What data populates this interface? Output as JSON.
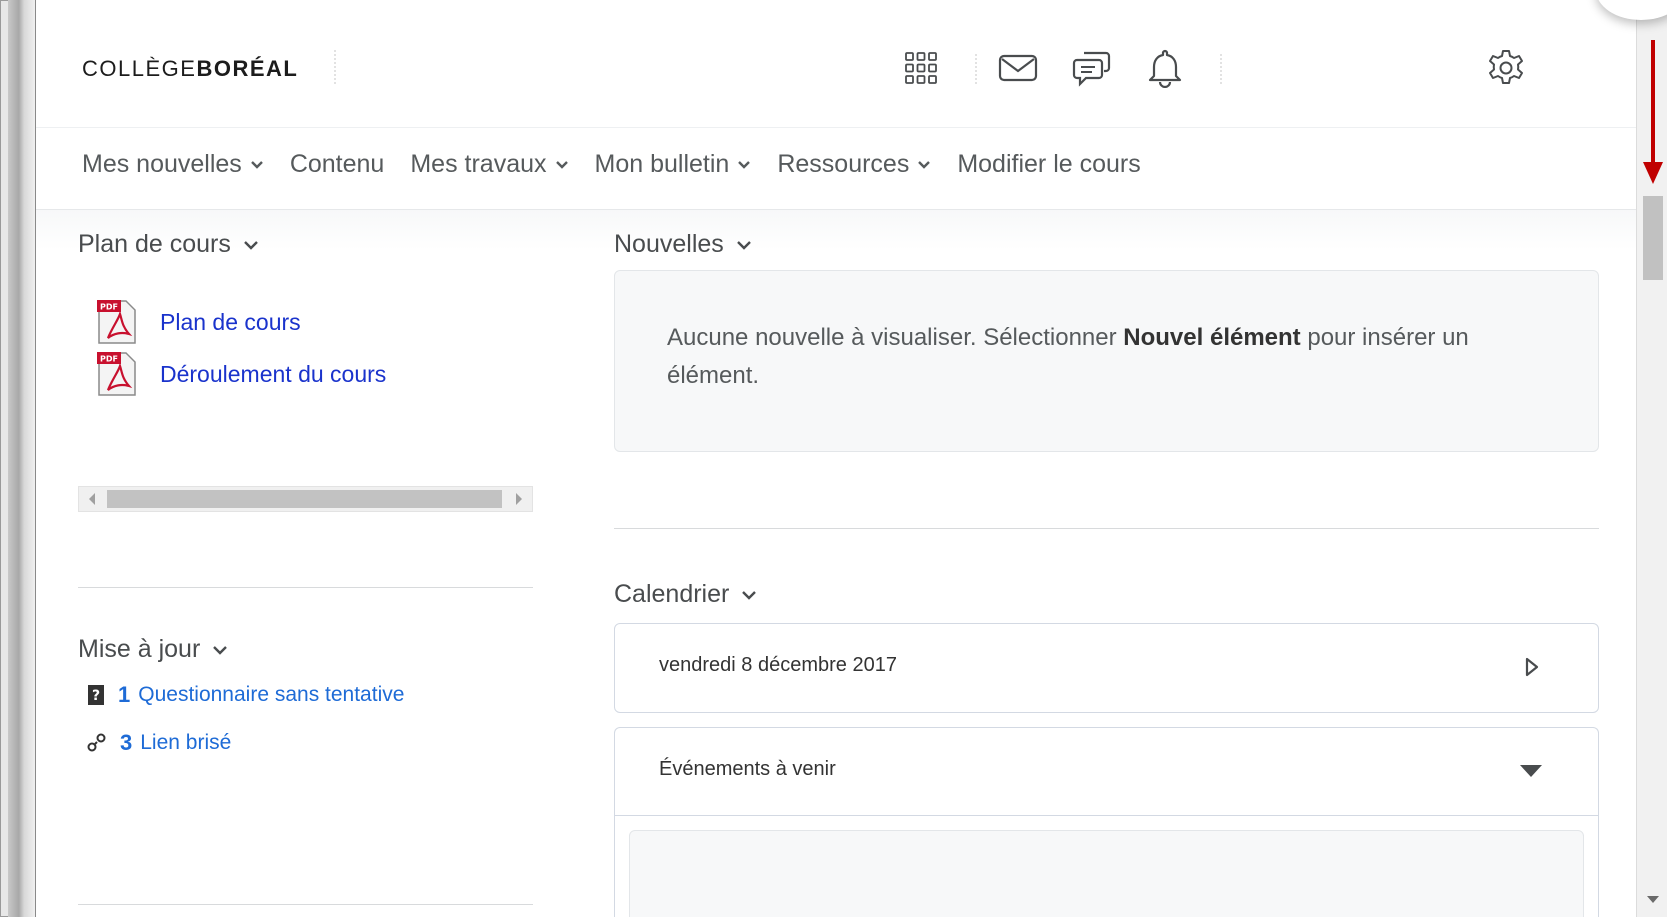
{
  "brand": {
    "light": "COLLÈGE",
    "bold": "BORÉAL"
  },
  "header_icons": [
    "waffle-grid-icon",
    "mail-icon",
    "chat-icon",
    "bell-icon",
    "gear-icon"
  ],
  "nav": {
    "items": [
      {
        "label": "Mes nouvelles",
        "dropdown": true
      },
      {
        "label": "Contenu",
        "dropdown": false
      },
      {
        "label": "Mes travaux",
        "dropdown": true
      },
      {
        "label": "Mon bulletin",
        "dropdown": true
      },
      {
        "label": "Ressources",
        "dropdown": true
      },
      {
        "label": "Modifier le cours",
        "dropdown": false
      }
    ]
  },
  "course_plan": {
    "title": "Plan de cours",
    "links": [
      "Plan de cours",
      "Déroulement du cours"
    ]
  },
  "news": {
    "title": "Nouvelles",
    "text_before": "Aucune nouvelle à visualiser. Sélectionner ",
    "text_bold": "Nouvel élément",
    "text_after": " pour insérer un élément."
  },
  "calendar": {
    "title": "Calendrier",
    "date": "vendredi 8 décembre 2017",
    "upcoming": "Événements à venir"
  },
  "updates": {
    "title": "Mise à jour",
    "rows": [
      {
        "count": "1",
        "label": "Questionnaire sans tentative",
        "icon": "quiz-icon"
      },
      {
        "count": "3",
        "label": "Lien brisé",
        "icon": "broken-link-icon"
      }
    ]
  },
  "colors": {
    "link": "#1a33cc",
    "update_link": "#1e6bd6",
    "annotation_arrow": "#c00000"
  }
}
